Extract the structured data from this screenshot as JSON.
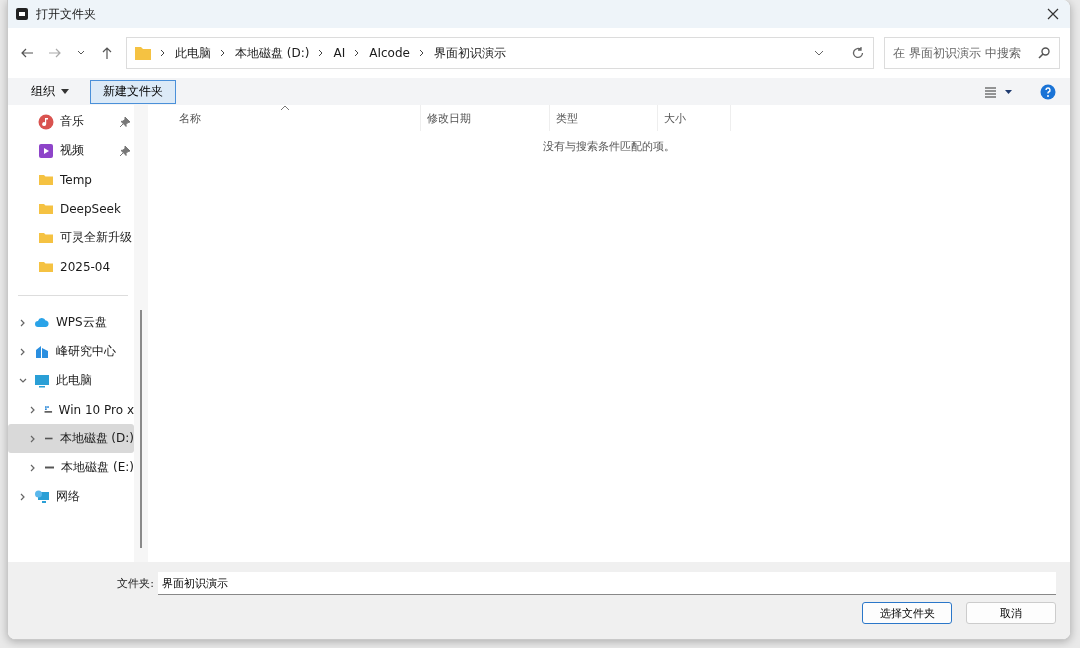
{
  "window": {
    "title": "打开文件夹"
  },
  "navigation": {
    "back_disabled": false,
    "forward_disabled": true
  },
  "address_bar": {
    "segments": [
      "此电脑",
      "本地磁盘 (D:)",
      "AI",
      "AIcode",
      "界面初识演示"
    ]
  },
  "search": {
    "placeholder": "在 界面初识演示 中搜索"
  },
  "toolbar": {
    "organize": "组织",
    "new_folder": "新建文件夹"
  },
  "quick_access": [
    {
      "kind": "music",
      "label": "音乐",
      "pinned": true
    },
    {
      "kind": "video",
      "label": "视频",
      "pinned": true
    },
    {
      "kind": "folder",
      "label": "Temp",
      "pinned": false
    },
    {
      "kind": "folder",
      "label": "DeepSeek",
      "pinned": false
    },
    {
      "kind": "folder",
      "label": "可灵全新升级",
      "pinned": false
    },
    {
      "kind": "folder",
      "label": "2025-04",
      "pinned": false
    }
  ],
  "tree": [
    {
      "kind": "cloud",
      "label": "WPS云盘",
      "expanded": false,
      "selected": false
    },
    {
      "kind": "app",
      "label": "峰研究中心",
      "expanded": false,
      "selected": false
    },
    {
      "kind": "pc",
      "label": "此电脑",
      "expanded": true,
      "selected": false,
      "children": [
        {
          "kind": "os-drive",
          "label": "Win 10 Pro x",
          "expanded": false,
          "selected": false
        },
        {
          "kind": "drive",
          "label": "本地磁盘 (D:)",
          "expanded": false,
          "selected": true
        },
        {
          "kind": "drive",
          "label": "本地磁盘 (E:)",
          "expanded": false,
          "selected": false
        }
      ]
    },
    {
      "kind": "network",
      "label": "网络",
      "expanded": false,
      "selected": false
    }
  ],
  "table": {
    "columns": [
      "名称",
      "修改日期",
      "类型",
      "大小"
    ],
    "empty_message": "没有与搜索条件匹配的项。"
  },
  "footer": {
    "folder_label": "文件夹:",
    "folder_value": "界面初识演示",
    "buttons": [
      {
        "label": "选择文件夹",
        "primary": true
      },
      {
        "label": "取消",
        "primary": false
      }
    ]
  }
}
